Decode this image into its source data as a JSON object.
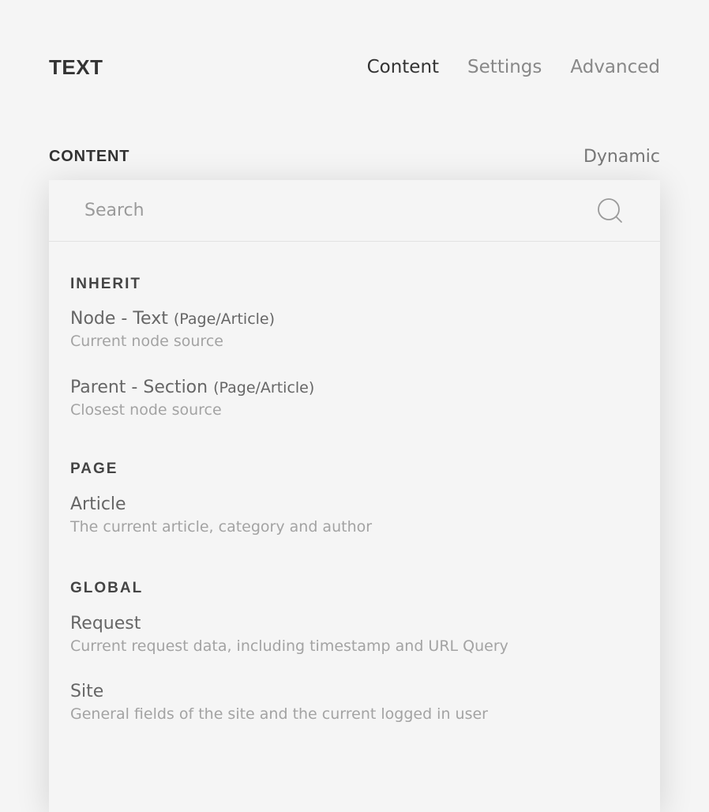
{
  "header": {
    "title": "TEXT",
    "tabs": [
      {
        "label": "Content"
      },
      {
        "label": "Settings"
      },
      {
        "label": "Advanced"
      }
    ]
  },
  "section": {
    "label": "CONTENT",
    "dynamic_label": "Dynamic"
  },
  "search": {
    "value": "",
    "placeholder": "Search",
    "icon": "search-icon"
  },
  "groups": [
    {
      "title": "INHERIT",
      "items": [
        {
          "title": "Node - Text",
          "suffix": "(Page/Article)",
          "description": "Current node source"
        },
        {
          "title": "Parent - Section",
          "suffix": "(Page/Article)",
          "description": "Closest node source"
        }
      ]
    },
    {
      "title": "PAGE",
      "items": [
        {
          "title": "Article",
          "description": "The current article, category and author"
        }
      ]
    },
    {
      "title": "GLOBAL",
      "items": [
        {
          "title": "Request",
          "description": "Current request data, including timestamp and URL Query"
        },
        {
          "title": "Site",
          "description": "General fields of the site and the current logged in user"
        }
      ]
    }
  ],
  "colors": {
    "background": "#f5f5f5",
    "text_dark": "#333333",
    "text_muted": "#888888",
    "text_desc": "#a3a3a3"
  }
}
